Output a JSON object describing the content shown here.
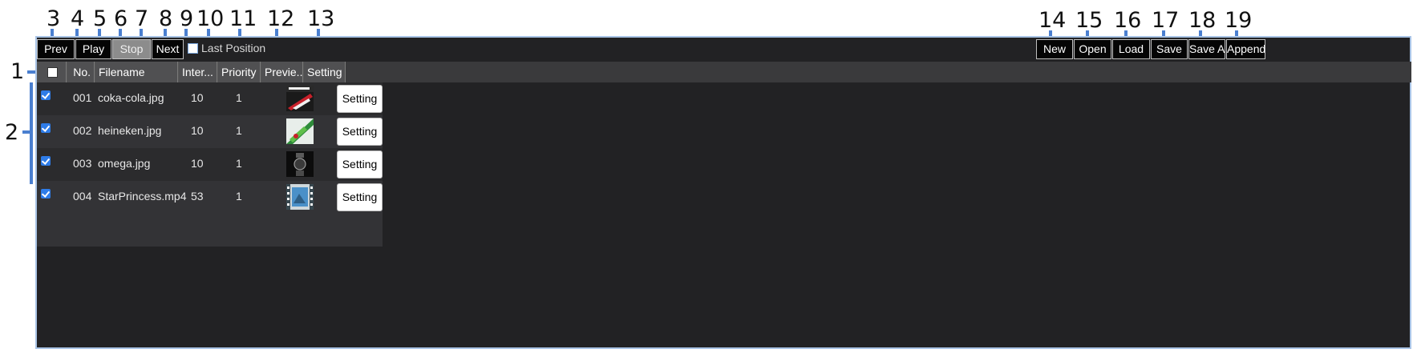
{
  "callouts": [
    "1",
    "2",
    "3",
    "4",
    "5",
    "6",
    "7",
    "8",
    "9",
    "10",
    "11",
    "12",
    "13",
    "14",
    "15",
    "16",
    "17",
    "18",
    "19"
  ],
  "toolbar": {
    "prev": "Prev",
    "play": "Play",
    "stop": "Stop",
    "next": "Next",
    "last_position_label": "Last Position",
    "new": "New",
    "open": "Open",
    "load": "Load",
    "save": "Save",
    "save_as": "Save As",
    "append": "Append"
  },
  "columns": {
    "no": "No.",
    "filename": "Filename",
    "interval": "Inter...",
    "priority": "Priority",
    "preview": "Previe...",
    "setting": "Setting"
  },
  "rows": [
    {
      "no": "001",
      "filename": "coka-cola.jpg",
      "interval": "10",
      "priority": "1",
      "setting": "Setting",
      "checked": true,
      "thumb": "red"
    },
    {
      "no": "002",
      "filename": "heineken.jpg",
      "interval": "10",
      "priority": "1",
      "setting": "Setting",
      "checked": true,
      "thumb": "green"
    },
    {
      "no": "003",
      "filename": "omega.jpg",
      "interval": "10",
      "priority": "1",
      "setting": "Setting",
      "checked": true,
      "thumb": "dark"
    },
    {
      "no": "004",
      "filename": "StarPrincess.mp4",
      "interval": "53",
      "priority": "1",
      "setting": "Setting",
      "checked": true,
      "thumb": "video"
    }
  ],
  "colors": {
    "accent": "#4a7fd0",
    "window_bg": "#222224",
    "check_blue": "#2e7ce8"
  }
}
